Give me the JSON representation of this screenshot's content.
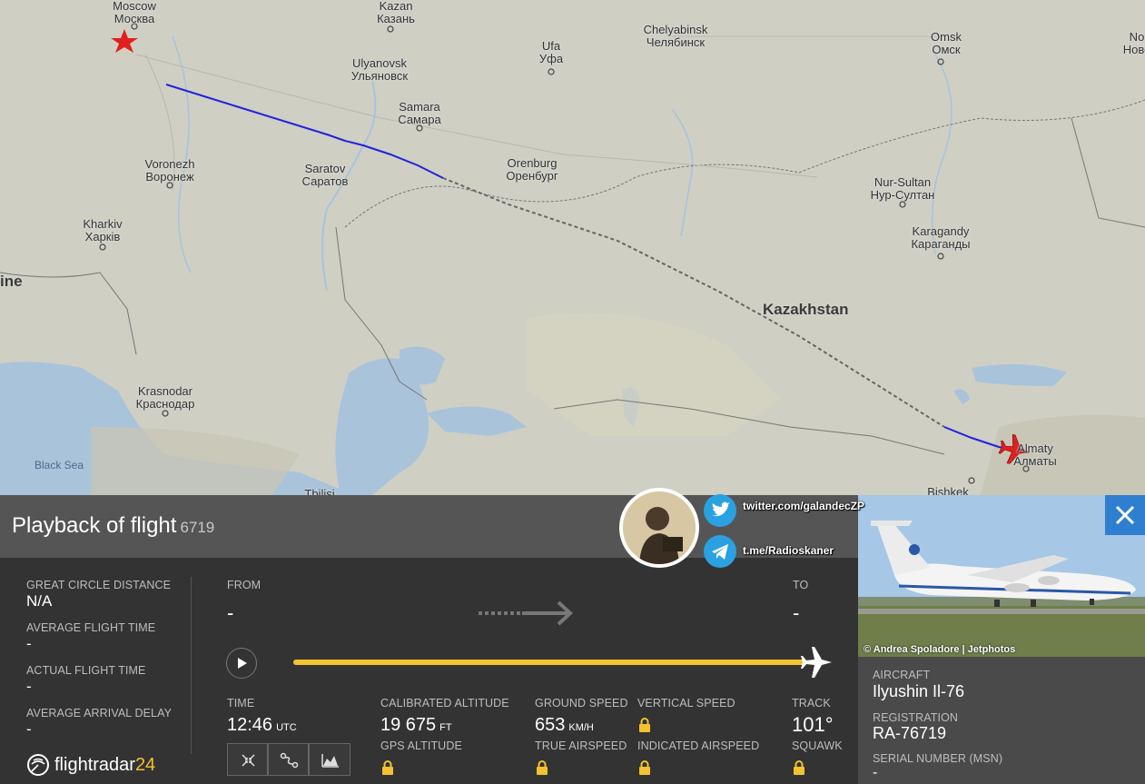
{
  "map": {
    "cities": [
      {
        "name": "Moscow",
        "local": "Москва"
      },
      {
        "name": "Kazan",
        "local": "Казань"
      },
      {
        "name": "Chelyabinsk",
        "local": "Челябинск"
      },
      {
        "name": "Ufa",
        "local": "Уфа"
      },
      {
        "name": "Omsk",
        "local": "Омск"
      },
      {
        "name": "No",
        "local": "Нове"
      },
      {
        "name": "Ulyanovsk",
        "local": "Ульяновск"
      },
      {
        "name": "Samara",
        "local": "Самара"
      },
      {
        "name": "Voronezh",
        "local": "Воронеж"
      },
      {
        "name": "Saratov",
        "local": "Саратов"
      },
      {
        "name": "Orenburg",
        "local": "Оренбург"
      },
      {
        "name": "Nur-Sultan",
        "local": "Нур-Султан"
      },
      {
        "name": "Kharkiv",
        "local": "Харків"
      },
      {
        "name": "Karagandy",
        "local": "Караганды"
      },
      {
        "name": "Krasnodar",
        "local": "Краснодар"
      },
      {
        "name": "Almaty",
        "local": "Алматы"
      },
      {
        "name": "Bishkek",
        "local": ""
      },
      {
        "name": "Tbilisi",
        "local": ""
      }
    ],
    "country_kazakhstan": "Kazakhstan",
    "country_ukraine_partial": "ine",
    "sea_black": "Black Sea"
  },
  "panel": {
    "title": "Playback of flight",
    "flight_number": "6719",
    "left_stats": [
      {
        "label": "GREAT CIRCLE DISTANCE",
        "value": "N/A"
      },
      {
        "label": "AVERAGE FLIGHT TIME",
        "value": "-"
      },
      {
        "label": "ACTUAL FLIGHT TIME",
        "value": "-"
      },
      {
        "label": "AVERAGE ARRIVAL DELAY",
        "value": "-"
      }
    ],
    "from_label": "FROM",
    "from_value": "-",
    "to_label": "TO",
    "to_value": "-",
    "progress": 1.0,
    "time_label": "TIME",
    "time_value": "12:46",
    "time_unit": "UTC",
    "cal_alt_label": "CALIBRATED ALTITUDE",
    "cal_alt_value": "19 675",
    "cal_alt_unit": "FT",
    "gps_alt_label": "GPS ALTITUDE",
    "ground_speed_label": "GROUND SPEED",
    "ground_speed_value": "653",
    "ground_speed_unit": "KM/H",
    "true_airspeed_label": "TRUE AIRSPEED",
    "vertical_speed_label": "VERTICAL SPEED",
    "indicated_airspeed_label": "INDICATED AIRSPEED",
    "track_label": "TRACK",
    "track_value": "101°",
    "squawk_label": "SQUAWK",
    "logo_text": "flightradar",
    "logo_num": "24"
  },
  "aircraft_info": {
    "photo_credit": "© Andrea Spoladore | Jetphotos",
    "aircraft_label": "AIRCRAFT",
    "aircraft_value": "Ilyushin Il-76",
    "registration_label": "REGISTRATION",
    "registration_value": "RA-76719",
    "serial_label": "SERIAL NUMBER (MSN)",
    "serial_value": "-"
  },
  "overlay": {
    "twitter": "twitter.com/galandecZP",
    "telegram": "t.me/Radioskaner"
  },
  "colors": {
    "flight_path": "#2222dd",
    "progress": "#f2c230",
    "close_button": "#2f7fd0",
    "aircraft_marker": "#e02020"
  }
}
